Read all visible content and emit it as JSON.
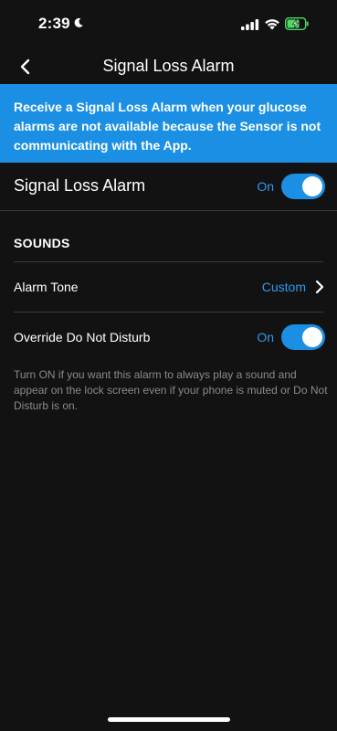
{
  "status_bar": {
    "time": "2:39",
    "icons": [
      "moon-icon",
      "cellular-signal-icon",
      "wifi-icon",
      "battery-charging-icon"
    ]
  },
  "nav": {
    "title": "Signal Loss Alarm",
    "back_icon": "chevron-left-icon"
  },
  "banner": {
    "text": "Receive a Signal Loss Alarm when your glucose alarms are not available because the Sensor is not communicating with the App."
  },
  "main_toggle": {
    "label": "Signal Loss Alarm",
    "value": "On",
    "enabled": true
  },
  "sounds": {
    "header": "SOUNDS",
    "alarm_tone": {
      "label": "Alarm Tone",
      "value": "Custom"
    },
    "override_dnd": {
      "label": "Override Do Not Disturb",
      "value": "On",
      "enabled": true
    },
    "footnote": "Turn ON if you want this alarm to always play a sound and appear on the lock screen even if your phone is muted or Do Not Disturb is on."
  },
  "colors": {
    "accent": "#1a8fe3",
    "accent_text": "#2b9af3",
    "background": "#121212",
    "divider": "#3a3a3c",
    "muted_text": "#8a8a8e"
  }
}
